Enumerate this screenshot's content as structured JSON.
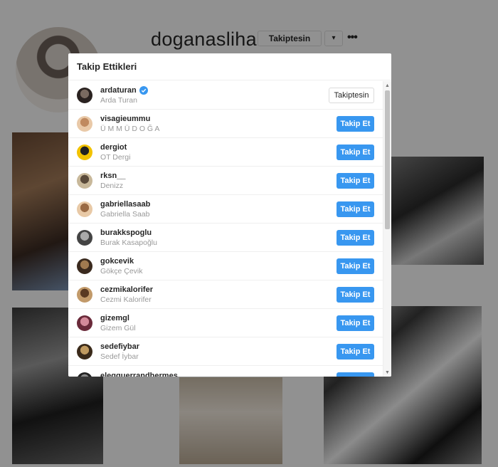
{
  "background": {
    "username": "doganaslihan",
    "follow_status": "Takiptesin",
    "dropdown_glyph": "▾",
    "more_glyph": "•••"
  },
  "modal": {
    "title": "Takip Ettikleri",
    "rows": [
      {
        "username": "ardaturan",
        "name": "Arda Turan",
        "verified": true,
        "button": "Takiptesin",
        "following": true,
        "avatar_colors": [
          "#2a2220",
          "#7a6a60"
        ]
      },
      {
        "username": "visagieummu",
        "name": "Ü M M Ü D O Ğ A",
        "verified": false,
        "button": "Takip Et",
        "following": false,
        "avatar_colors": [
          "#e9c9a8",
          "#c08a60"
        ]
      },
      {
        "username": "dergiot",
        "name": "OT Dergi",
        "verified": false,
        "button": "Takip Et",
        "following": false,
        "avatar_colors": [
          "#f2c200",
          "#222222"
        ]
      },
      {
        "username": "rksn__",
        "name": "Denizz",
        "verified": false,
        "button": "Takip Et",
        "following": false,
        "avatar_colors": [
          "#c8b89a",
          "#5a4a3a"
        ]
      },
      {
        "username": "gabriellasaab",
        "name": "Gabriella Saab",
        "verified": false,
        "button": "Takip Et",
        "following": false,
        "avatar_colors": [
          "#e8c9a6",
          "#9a6a44"
        ]
      },
      {
        "username": "burakkspoglu",
        "name": "Burak Kasapoğlu",
        "verified": false,
        "button": "Takip Et",
        "following": false,
        "avatar_colors": [
          "#444444",
          "#aaaaaa"
        ]
      },
      {
        "username": "gokcevik",
        "name": "Gökçe Çevik",
        "verified": false,
        "button": "Takip Et",
        "following": false,
        "avatar_colors": [
          "#3a2a1e",
          "#a07a50"
        ]
      },
      {
        "username": "cezmikalorifer",
        "name": "Cezmi Kalorifer",
        "verified": false,
        "button": "Takip Et",
        "following": false,
        "avatar_colors": [
          "#c29a6a",
          "#5a3a22"
        ]
      },
      {
        "username": "gizemgl",
        "name": "Gizem Gül",
        "verified": false,
        "button": "Takip Et",
        "following": false,
        "avatar_colors": [
          "#6a2a3a",
          "#d48a9a"
        ]
      },
      {
        "username": "sedefiybar",
        "name": "Sedef İybar",
        "verified": false,
        "button": "Takip Et",
        "following": false,
        "avatar_colors": [
          "#3a2a1a",
          "#c09a60"
        ]
      },
      {
        "username": "eleqguerrandhermes",
        "name": "",
        "verified": false,
        "button": "Takip Et",
        "following": false,
        "avatar_colors": [
          "#222222",
          "#888888"
        ]
      }
    ]
  },
  "colors": {
    "accent": "#3897f0",
    "verified": "#3897f0",
    "secondary_text": "#999999"
  },
  "icons": {
    "verified": "verified-badge-icon",
    "scroll_up": "scroll-up-arrow-icon",
    "scroll_down": "scroll-down-arrow-icon"
  }
}
